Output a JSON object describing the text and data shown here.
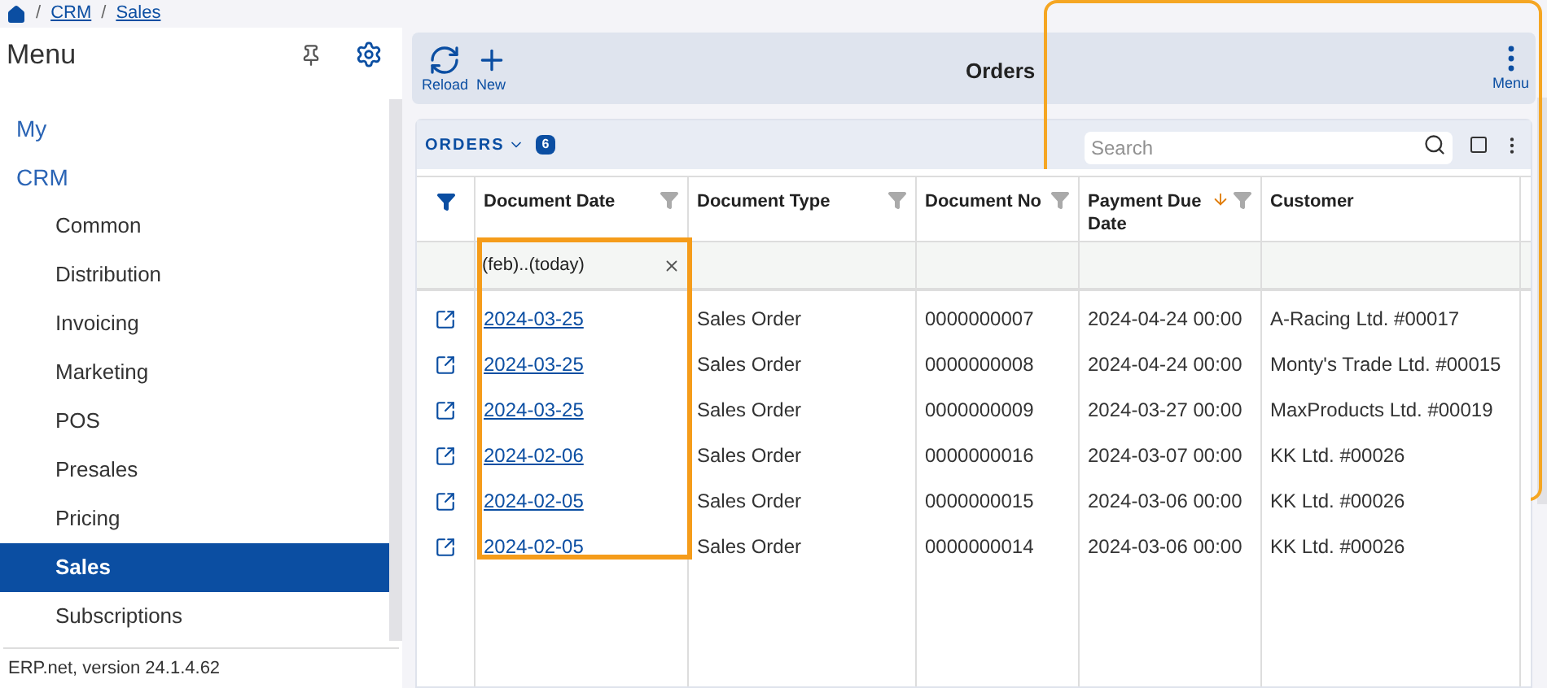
{
  "breadcrumb": [
    {
      "separator": "/",
      "label": "CRM"
    },
    {
      "separator": "/",
      "label": "Sales"
    }
  ],
  "sidebar": {
    "title": "Menu",
    "items": [
      {
        "label": "My",
        "selected": false
      },
      {
        "label": "CRM",
        "selected": false,
        "children": [
          {
            "label": "Common",
            "selected": false
          },
          {
            "label": "Distribution",
            "selected": false
          },
          {
            "label": "Invoicing",
            "selected": false
          },
          {
            "label": "Marketing",
            "selected": false
          },
          {
            "label": "POS",
            "selected": false
          },
          {
            "label": "Presales",
            "selected": false
          },
          {
            "label": "Pricing",
            "selected": false
          },
          {
            "label": "Sales",
            "selected": true
          },
          {
            "label": "Subscriptions",
            "selected": false
          }
        ]
      }
    ],
    "footer": "ERP.net, version 24.1.4.62"
  },
  "toolbar": {
    "title": "Orders",
    "buttons": [
      {
        "kind": "reload",
        "label": "Reload"
      },
      {
        "kind": "new",
        "label": "New"
      }
    ],
    "menu_label": "Menu"
  },
  "panel": {
    "title": "ORDERS",
    "count": "6",
    "search": {
      "placeholder": "Search"
    }
  },
  "table": {
    "filter_row_active": true,
    "columns": [
      {
        "label": "Document Date",
        "filterable": true,
        "sorted": false,
        "filter_value": "(feb)..(today)",
        "highlighted": true
      },
      {
        "label": "Document Type",
        "filterable": true,
        "sorted": false,
        "highlighted": false
      },
      {
        "label": "Document No",
        "filterable": true,
        "sorted": false,
        "highlighted": false
      },
      {
        "label": "Payment Due Date",
        "filterable": true,
        "sorted": true,
        "highlighted": false
      },
      {
        "label": "Customer",
        "filterable": false,
        "sorted": false,
        "highlighted": false
      }
    ],
    "rows": [
      [
        "2024-03-25",
        "Sales Order",
        "0000000007",
        "2024-04-24 00:00",
        "A-Racing Ltd. #00017"
      ],
      [
        "2024-03-25",
        "Sales Order",
        "0000000008",
        "2024-04-24 00:00",
        "Monty's Trade Ltd. #00015"
      ],
      [
        "2024-03-25",
        "Sales Order",
        "0000000009",
        "2024-03-27 00:00",
        "MaxProducts Ltd. #00019"
      ],
      [
        "2024-02-06",
        "Sales Order",
        "0000000016",
        "2024-03-07 00:00",
        "KK Ltd. #00026"
      ],
      [
        "2024-02-05",
        "Sales Order",
        "0000000015",
        "2024-03-06 00:00",
        "KK Ltd. #00026"
      ],
      [
        "2024-02-05",
        "Sales Order",
        "0000000014",
        "2024-03-06 00:00",
        "KK Ltd. #00026"
      ]
    ]
  }
}
